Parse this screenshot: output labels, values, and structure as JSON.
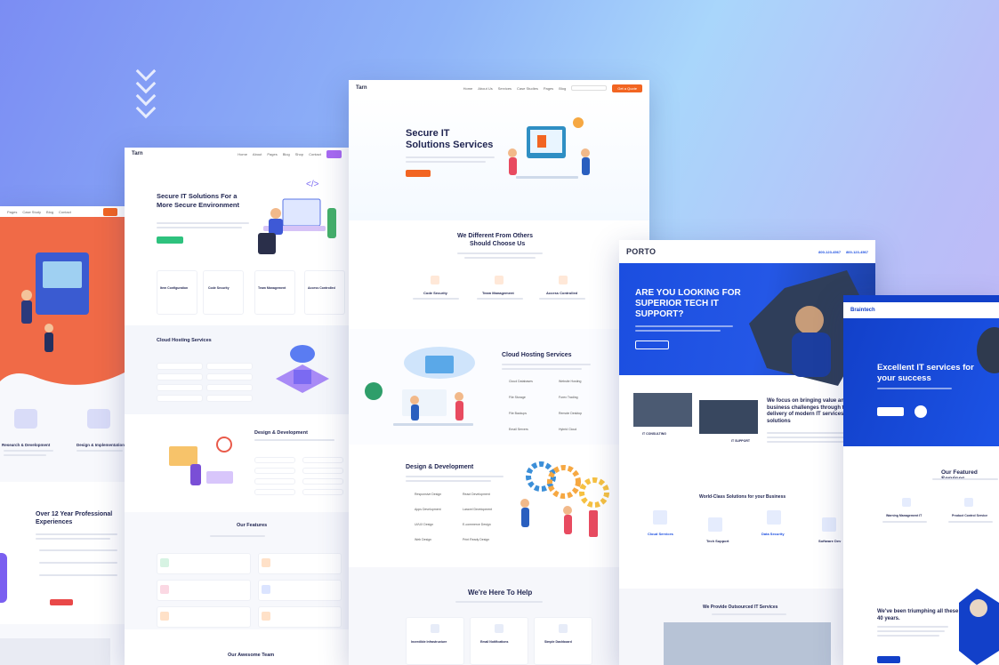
{
  "screens": {
    "left_partial": {
      "nav": [
        "Pages",
        "Case Study",
        "Blog",
        "Contact"
      ],
      "features": [
        "Research & Development",
        "Design & Implementation"
      ],
      "experience_title": "Over 12 Year Professional Experiences"
    },
    "second": {
      "brand": "Tarn",
      "nav": [
        "Home",
        "About",
        "Pages",
        "Blog",
        "Shop",
        "Contact"
      ],
      "hero_title": "Secure IT Solutions For a More Secure Environment",
      "services": [
        "Item Configuration",
        "Code Security",
        "Team Management",
        "Access Controlled"
      ],
      "cloud_title": "Cloud Hosting Services",
      "design_title": "Design & Development",
      "features_title": "Our Features",
      "team_title": "Our Awesome Team"
    },
    "center": {
      "brand": "Tarn",
      "nav": [
        "Home",
        "About Us",
        "Services",
        "Case Studies",
        "Pages",
        "Blog"
      ],
      "cta": "Get a Quote",
      "hero_title_line1": "Secure IT",
      "hero_title_line2": "Solutions Services",
      "why_title_line1": "We Different From Others",
      "why_title_line2": "Should Choose Us",
      "services": [
        "Code Security",
        "Team Management",
        "Access Controlled"
      ],
      "cloud_title": "Cloud Hosting Services",
      "cloud_items": [
        "Cloud Databases",
        "Website Hosting",
        "File Storage",
        "Forex Trading",
        "File Backups",
        "Remote Desktop",
        "Email Servers",
        "Hybrid Cloud"
      ],
      "design_title": "Design & Development",
      "design_items": [
        "Responsive Design",
        "React Development",
        "Apps Development",
        "Laravel Development",
        "UI/UX Design",
        "E-commerce Design",
        "Web Design",
        "Print Ready Design"
      ],
      "help_title": "We're Here To Help",
      "help_items": [
        "Incredible Infrastructure",
        "Email Notifications",
        "Simple Dashboard"
      ]
    },
    "porto": {
      "brand": "PORTO",
      "phones": [
        "800-123-4567",
        "800-123-4567"
      ],
      "hero_title": "ARE YOU LOOKING FOR SUPERIOR TECH IT SUPPORT?",
      "solving_title": "We focus on bringing value and solve business challenges through the delivery of modern IT services and solutions",
      "labels": [
        "IT CONSULTING",
        "IT SUPPORT"
      ],
      "solutions_title": "World-Class Solutions for your Business",
      "solutions": [
        "Cloud Services",
        "Tech Support",
        "Data Security",
        "Software Dev"
      ],
      "outsourced_title": "We Provide Outsourced IT Services"
    },
    "braintech": {
      "brand": "Braintech",
      "hero_title": "Excellent IT services for your success",
      "services_title": "Our Featured Services",
      "services": [
        "Warning Management IT",
        "Product Control Service"
      ],
      "since_title": "We've been triumphing all these 40 years."
    }
  },
  "colors": {
    "orange": "#f26522",
    "porto_blue": "#1b4ee0",
    "braintech_blue": "#1240c9",
    "navy": "#1f2450"
  }
}
